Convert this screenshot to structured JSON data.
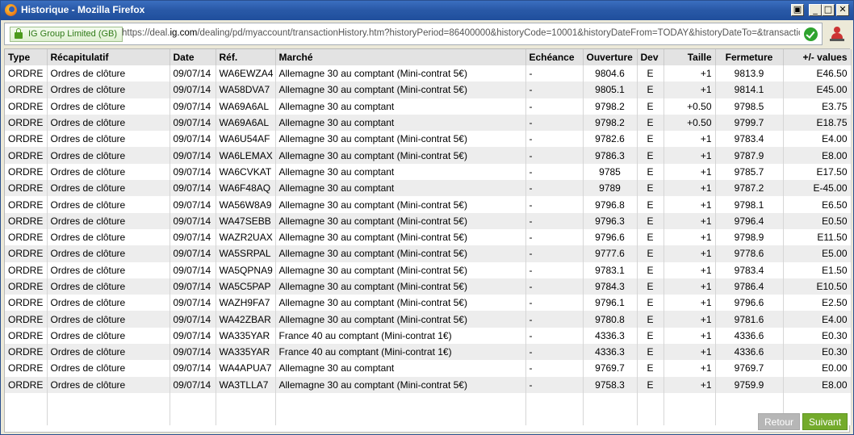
{
  "window": {
    "title": "Historique - Mozilla Firefox"
  },
  "urlbar": {
    "site_identity": "IG Group Limited (GB)",
    "url_prefix": "https://deal.",
    "url_host": "ig.com",
    "url_rest": "/dealing/pd/myaccount/transactionHistory.htm?historyPeriod=86400000&historyCode=10001&historyDateFrom=TODAY&historyDateTo=&transactionHistor"
  },
  "table": {
    "headers": [
      "Type",
      "Récapitulatif",
      "Date",
      "Réf.",
      "Marché",
      "Echéance",
      "Ouverture",
      "Dev",
      "Taille",
      "Fermeture",
      "+/- values"
    ],
    "rows": [
      [
        "ORDRE",
        "Ordres de clôture",
        "09/07/14",
        "WA6EWZA4",
        "Allemagne 30 au comptant (Mini-contrat 5€)",
        "-",
        "9804.6",
        "E",
        "+1",
        "9813.9",
        "E46.50"
      ],
      [
        "ORDRE",
        "Ordres de clôture",
        "09/07/14",
        "WA58DVA7",
        "Allemagne 30 au comptant (Mini-contrat 5€)",
        "-",
        "9805.1",
        "E",
        "+1",
        "9814.1",
        "E45.00"
      ],
      [
        "ORDRE",
        "Ordres de clôture",
        "09/07/14",
        "WA69A6AL",
        "Allemagne 30 au comptant",
        "-",
        "9798.2",
        "E",
        "+0.50",
        "9798.5",
        "E3.75"
      ],
      [
        "ORDRE",
        "Ordres de clôture",
        "09/07/14",
        "WA69A6AL",
        "Allemagne 30 au comptant",
        "-",
        "9798.2",
        "E",
        "+0.50",
        "9799.7",
        "E18.75"
      ],
      [
        "ORDRE",
        "Ordres de clôture",
        "09/07/14",
        "WA6U54AF",
        "Allemagne 30 au comptant (Mini-contrat 5€)",
        "-",
        "9782.6",
        "E",
        "+1",
        "9783.4",
        "E4.00"
      ],
      [
        "ORDRE",
        "Ordres de clôture",
        "09/07/14",
        "WA6LEMAX",
        "Allemagne 30 au comptant (Mini-contrat 5€)",
        "-",
        "9786.3",
        "E",
        "+1",
        "9787.9",
        "E8.00"
      ],
      [
        "ORDRE",
        "Ordres de clôture",
        "09/07/14",
        "WA6CVKAT",
        "Allemagne 30 au comptant",
        "-",
        "9785",
        "E",
        "+1",
        "9785.7",
        "E17.50"
      ],
      [
        "ORDRE",
        "Ordres de clôture",
        "09/07/14",
        "WA6F48AQ",
        "Allemagne 30 au comptant",
        "-",
        "9789",
        "E",
        "+1",
        "9787.2",
        "E-45.00"
      ],
      [
        "ORDRE",
        "Ordres de clôture",
        "09/07/14",
        "WA56W8A9",
        "Allemagne 30 au comptant (Mini-contrat 5€)",
        "-",
        "9796.8",
        "E",
        "+1",
        "9798.1",
        "E6.50"
      ],
      [
        "ORDRE",
        "Ordres de clôture",
        "09/07/14",
        "WA47SEBB",
        "Allemagne 30 au comptant (Mini-contrat 5€)",
        "-",
        "9796.3",
        "E",
        "+1",
        "9796.4",
        "E0.50"
      ],
      [
        "ORDRE",
        "Ordres de clôture",
        "09/07/14",
        "WAZR2UAX",
        "Allemagne 30 au comptant (Mini-contrat 5€)",
        "-",
        "9796.6",
        "E",
        "+1",
        "9798.9",
        "E11.50"
      ],
      [
        "ORDRE",
        "Ordres de clôture",
        "09/07/14",
        "WA5SRPAL",
        "Allemagne 30 au comptant (Mini-contrat 5€)",
        "-",
        "9777.6",
        "E",
        "+1",
        "9778.6",
        "E5.00"
      ],
      [
        "ORDRE",
        "Ordres de clôture",
        "09/07/14",
        "WA5QPNA9",
        "Allemagne 30 au comptant (Mini-contrat 5€)",
        "-",
        "9783.1",
        "E",
        "+1",
        "9783.4",
        "E1.50"
      ],
      [
        "ORDRE",
        "Ordres de clôture",
        "09/07/14",
        "WA5C5PAP",
        "Allemagne 30 au comptant (Mini-contrat 5€)",
        "-",
        "9784.3",
        "E",
        "+1",
        "9786.4",
        "E10.50"
      ],
      [
        "ORDRE",
        "Ordres de clôture",
        "09/07/14",
        "WAZH9FA7",
        "Allemagne 30 au comptant (Mini-contrat 5€)",
        "-",
        "9796.1",
        "E",
        "+1",
        "9796.6",
        "E2.50"
      ],
      [
        "ORDRE",
        "Ordres de clôture",
        "09/07/14",
        "WA42ZBAR",
        "Allemagne 30 au comptant (Mini-contrat 5€)",
        "-",
        "9780.8",
        "E",
        "+1",
        "9781.6",
        "E4.00"
      ],
      [
        "ORDRE",
        "Ordres de clôture",
        "09/07/14",
        "WA335YAR",
        "France 40 au comptant (Mini-contrat 1€)",
        "-",
        "4336.3",
        "E",
        "+1",
        "4336.6",
        "E0.30"
      ],
      [
        "ORDRE",
        "Ordres de clôture",
        "09/07/14",
        "WA335YAR",
        "France 40 au comptant (Mini-contrat 1€)",
        "-",
        "4336.3",
        "E",
        "+1",
        "4336.6",
        "E0.30"
      ],
      [
        "ORDRE",
        "Ordres de clôture",
        "09/07/14",
        "WA4APUA7",
        "Allemagne 30 au comptant",
        "-",
        "9769.7",
        "E",
        "+1",
        "9769.7",
        "E0.00"
      ],
      [
        "ORDRE",
        "Ordres de clôture",
        "09/07/14",
        "WA3TLLA7",
        "Allemagne 30 au comptant (Mini-contrat 5€)",
        "-",
        "9758.3",
        "E",
        "+1",
        "9759.9",
        "E8.00"
      ]
    ]
  },
  "buttons": {
    "retour": "Retour",
    "suivant": "Suivant"
  },
  "colors": {
    "accent_green": "#74ab2c",
    "button_disabled": "#b6b6b6",
    "title_bar": "#2a5aa8"
  }
}
